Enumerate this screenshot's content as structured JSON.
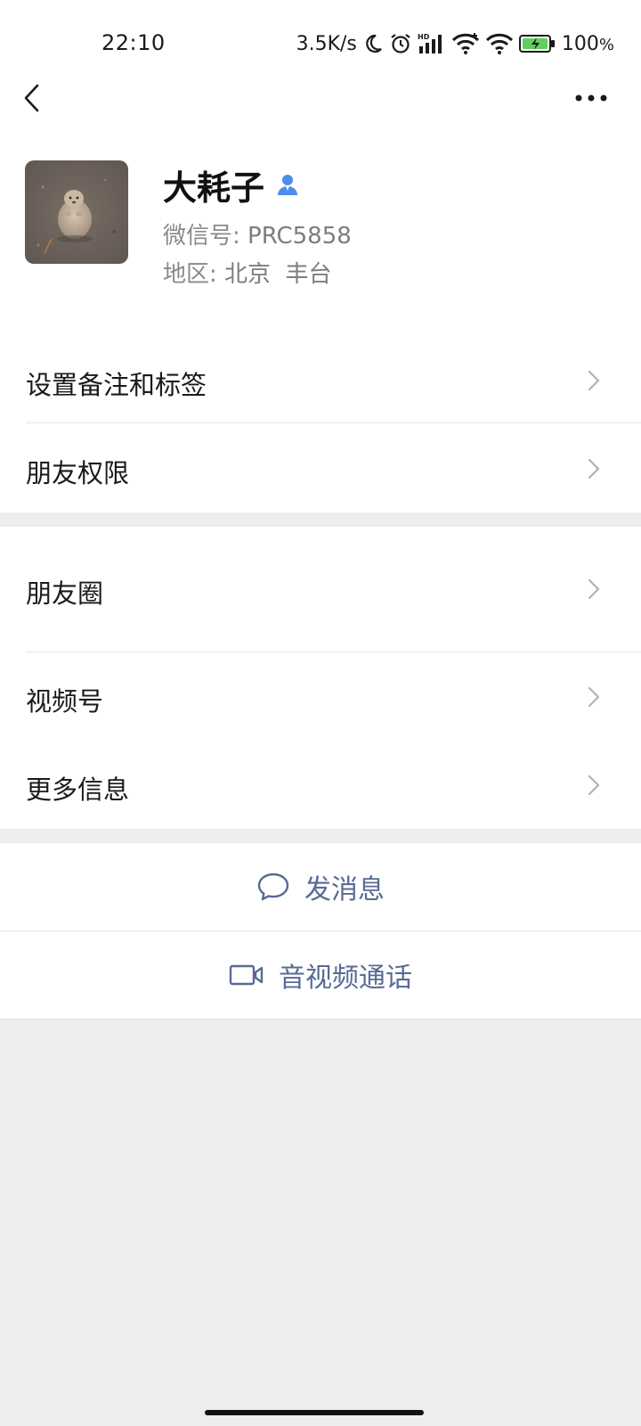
{
  "status_bar": {
    "time": "22:10",
    "network_speed": "3.5K/s",
    "battery": "100",
    "battery_unit": "%",
    "icons": [
      "moon-icon",
      "alarm-icon",
      "hd-signal-icon",
      "wifi-icon",
      "wifi-plus-icon",
      "battery-charging-icon"
    ]
  },
  "nav": {
    "back_icon": "back-arrow-icon",
    "more_icon": "more-dots-icon"
  },
  "profile": {
    "name": "大耗子",
    "gender_icon": "male-person-icon",
    "wechat_id_label": "微信号: ",
    "wechat_id": "PRC5858",
    "region_label": "地区: ",
    "region": "北京  丰台"
  },
  "menu": {
    "remark_tags": "设置备注和标签",
    "permissions": "朋友权限",
    "moments": "朋友圈",
    "channels": "视频号",
    "more_info": "更多信息"
  },
  "actions": {
    "send_message": "发消息",
    "av_call": "音视频通话"
  },
  "colors": {
    "link": "#576b95",
    "background": "#ededed",
    "gender_blue": "#4f8ee8"
  }
}
